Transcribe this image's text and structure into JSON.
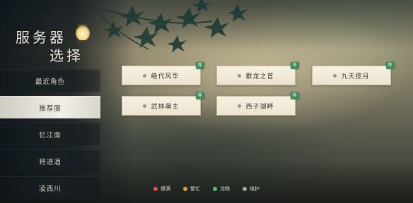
{
  "title": {
    "line1": "服务器",
    "line2": "选择"
  },
  "sidebar": {
    "items": [
      {
        "label": "最近角色"
      },
      {
        "label": "推荐服"
      },
      {
        "label": "忆江南"
      },
      {
        "label": "将进酒"
      },
      {
        "label": "凌西川"
      }
    ],
    "active_index": 1
  },
  "servers": [
    {
      "name": "绝代风华",
      "badge": "荐"
    },
    {
      "name": "群龙之首",
      "badge": "荐"
    },
    {
      "name": "九天揽月",
      "badge": "荐"
    },
    {
      "name": "武林萌主",
      "badge": "荐"
    },
    {
      "name": "西子湖畔",
      "badge": "荐"
    }
  ],
  "legend": [
    {
      "label": "爆满",
      "color": "#d9534f"
    },
    {
      "label": "繁忙",
      "color": "#e0a030"
    },
    {
      "label": "流畅",
      "color": "#4cc36a"
    },
    {
      "label": "维护",
      "color": "#a8a8a8"
    }
  ],
  "colors": {
    "badge": "#3f8a5a",
    "card": "#f3eddc",
    "active_tab": "#f1efe6"
  },
  "icons": {
    "lantern": "lantern-icon",
    "foliage": "maple-leaves-icon",
    "server_dot": "status-dot-icon"
  }
}
